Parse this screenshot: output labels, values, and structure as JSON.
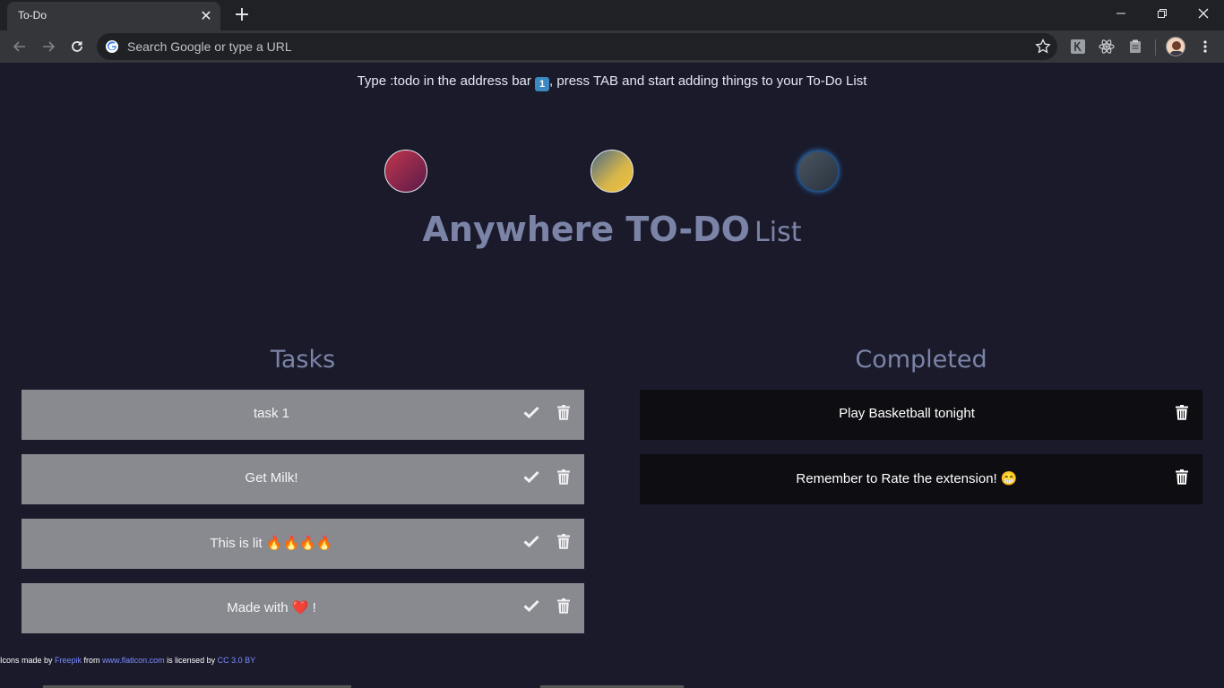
{
  "browser": {
    "tab_title": "To-Do",
    "tab_close": "✕",
    "new_tab": "+",
    "omnibox_placeholder": "Search Google or type a URL"
  },
  "page": {
    "hint_prefix": "Type :todo in the address bar ",
    "hint_key": "1",
    "hint_suffix": ", press TAB and start adding things to your To-Do List",
    "title_main": "Anywhere TO-DO",
    "title_sub": "List",
    "theme_colors": [
      "#c0364d",
      "#d6b64a",
      "#2a323c"
    ]
  },
  "tasks": {
    "heading": "Tasks",
    "items": [
      {
        "label": "task 1"
      },
      {
        "label": "Get Milk!"
      },
      {
        "label": "This is lit 🔥🔥🔥🔥"
      },
      {
        "label": "Made with ❤️ !"
      }
    ]
  },
  "completed": {
    "heading": "Completed",
    "items": [
      {
        "label": "Play Basketball tonight"
      },
      {
        "label": "Remember to Rate the extension! 😁"
      }
    ]
  },
  "footer": {
    "text1": "Icons made by ",
    "link1": "Freepik",
    "text2": " from ",
    "link2": "www.flaticon.com",
    "text3": " is licensed by ",
    "link3": "CC 3.0 BY"
  },
  "colors": {
    "background": "#1a1a2b",
    "task_bg": "#898a90",
    "completed_bg": "#0d0d12",
    "heading": "#7b84a7"
  }
}
